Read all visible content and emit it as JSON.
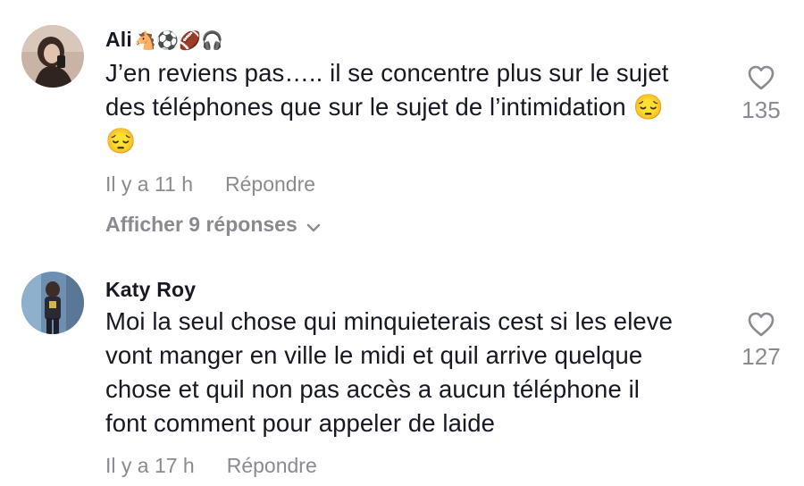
{
  "comments": [
    {
      "username": "Ali",
      "username_emojis": "🐴⚽🏈🎧",
      "text_line1": "J’en reviens pas….. il se concentre plus sur le sujet",
      "text_line2": "des téléphones que sur le sujet de l’intimidation 😔",
      "text_line3": "😔",
      "time": "Il y a 11 h",
      "reply_label": "Répondre",
      "view_replies_label": "Afficher 9 réponses",
      "like_count": "135",
      "like_icon": "heart-outline-icon"
    },
    {
      "username": "Katy Roy",
      "text_line1": "Moi la seul chose qui minquieterais cest si les eleve",
      "text_line2": "vont manger en ville le midi et quil arrive quelque",
      "text_line3": "chose et quil non pas accès a aucun téléphone il",
      "text_line4": "font comment pour appeler de laide",
      "time": "Il y a 17 h",
      "reply_label": "Répondre",
      "like_count": "127",
      "like_icon": "heart-outline-icon"
    }
  ],
  "colors": {
    "text_primary": "#161823",
    "text_secondary": "#8a8b91",
    "background": "#ffffff"
  }
}
